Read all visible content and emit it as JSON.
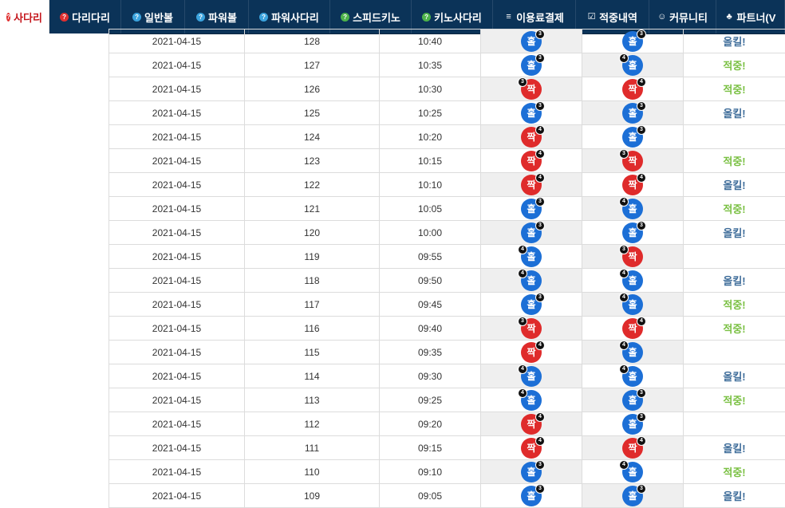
{
  "nav": {
    "items": [
      {
        "label": "사다리",
        "icon": "question-circle-icon",
        "icon_color": "red",
        "glyph": "?",
        "active": true,
        "width": 62
      },
      {
        "label": "다리다리",
        "icon": "question-circle-icon",
        "icon_color": "red",
        "glyph": "?",
        "active": false,
        "width": 90
      },
      {
        "label": "일반볼",
        "icon": "question-circle-icon",
        "icon_color": "blue",
        "glyph": "?",
        "active": false,
        "width": 80
      },
      {
        "label": "파워볼",
        "icon": "question-circle-icon",
        "icon_color": "blue",
        "glyph": "?",
        "active": false,
        "width": 80
      },
      {
        "label": "파워사다리",
        "icon": "question-circle-icon",
        "icon_color": "blue",
        "glyph": "?",
        "active": false,
        "width": 102
      },
      {
        "label": "스피드키노",
        "icon": "question-circle-icon",
        "icon_color": "green",
        "glyph": "?",
        "active": false,
        "width": 102
      },
      {
        "label": "키노사다리",
        "icon": "question-circle-icon",
        "icon_color": "green",
        "glyph": "?",
        "active": false,
        "width": 102
      },
      {
        "label": "이용료결제",
        "icon": "coins-icon",
        "icon_color": "white",
        "glyph": "≡",
        "active": false,
        "width": 104
      },
      {
        "label": "적중내역",
        "icon": "checkbox-icon",
        "icon_color": "white",
        "glyph": "☑",
        "active": false,
        "width": 92
      },
      {
        "label": "커뮤니티",
        "icon": "smiley-icon",
        "icon_color": "white",
        "glyph": "☺",
        "active": false,
        "width": 84
      },
      {
        "label": "파트너(V",
        "icon": "people-icon",
        "icon_color": "white",
        "glyph": "♣",
        "active": false,
        "width": 86
      }
    ]
  },
  "table": {
    "rows": [
      {
        "date": "2021-04-15",
        "round": "128",
        "time": "10:40",
        "b1": "홀",
        "b1t": "odd",
        "b1n": "3",
        "b1s": "right",
        "b2": "홀",
        "b2t": "odd",
        "b2n": "3",
        "b2s": "right",
        "result": "올킬!",
        "rtype": "miss"
      },
      {
        "date": "2021-04-15",
        "round": "127",
        "time": "10:35",
        "b1": "홀",
        "b1t": "odd",
        "b1n": "3",
        "b1s": "right",
        "b2": "홀",
        "b2t": "odd",
        "b2n": "4",
        "b2s": "left",
        "result": "적중!",
        "rtype": "hit"
      },
      {
        "date": "2021-04-15",
        "round": "126",
        "time": "10:30",
        "b1": "짝",
        "b1t": "even",
        "b1n": "3",
        "b1s": "left",
        "b2": "짝",
        "b2t": "even",
        "b2n": "4",
        "b2s": "right",
        "result": "적중!",
        "rtype": "hit"
      },
      {
        "date": "2021-04-15",
        "round": "125",
        "time": "10:25",
        "b1": "홀",
        "b1t": "odd",
        "b1n": "3",
        "b1s": "right",
        "b2": "홀",
        "b2t": "odd",
        "b2n": "3",
        "b2s": "right",
        "result": "올킬!",
        "rtype": "miss"
      },
      {
        "date": "2021-04-15",
        "round": "124",
        "time": "10:20",
        "b1": "짝",
        "b1t": "even",
        "b1n": "4",
        "b1s": "right",
        "b2": "홀",
        "b2t": "odd",
        "b2n": "3",
        "b2s": "right",
        "result": "",
        "rtype": ""
      },
      {
        "date": "2021-04-15",
        "round": "123",
        "time": "10:15",
        "b1": "짝",
        "b1t": "even",
        "b1n": "4",
        "b1s": "right",
        "b2": "짝",
        "b2t": "even",
        "b2n": "3",
        "b2s": "left",
        "result": "적중!",
        "rtype": "hit"
      },
      {
        "date": "2021-04-15",
        "round": "122",
        "time": "10:10",
        "b1": "짝",
        "b1t": "even",
        "b1n": "4",
        "b1s": "right",
        "b2": "짝",
        "b2t": "even",
        "b2n": "4",
        "b2s": "right",
        "result": "올킬!",
        "rtype": "miss"
      },
      {
        "date": "2021-04-15",
        "round": "121",
        "time": "10:05",
        "b1": "홀",
        "b1t": "odd",
        "b1n": "3",
        "b1s": "right",
        "b2": "홀",
        "b2t": "odd",
        "b2n": "4",
        "b2s": "left",
        "result": "적중!",
        "rtype": "hit"
      },
      {
        "date": "2021-04-15",
        "round": "120",
        "time": "10:00",
        "b1": "홀",
        "b1t": "odd",
        "b1n": "3",
        "b1s": "right",
        "b2": "홀",
        "b2t": "odd",
        "b2n": "3",
        "b2s": "right",
        "result": "올킬!",
        "rtype": "miss"
      },
      {
        "date": "2021-04-15",
        "round": "119",
        "time": "09:55",
        "b1": "홀",
        "b1t": "odd",
        "b1n": "4",
        "b1s": "left",
        "b2": "짝",
        "b2t": "even",
        "b2n": "3",
        "b2s": "left",
        "result": "",
        "rtype": ""
      },
      {
        "date": "2021-04-15",
        "round": "118",
        "time": "09:50",
        "b1": "홀",
        "b1t": "odd",
        "b1n": "4",
        "b1s": "left",
        "b2": "홀",
        "b2t": "odd",
        "b2n": "4",
        "b2s": "left",
        "result": "올킬!",
        "rtype": "miss"
      },
      {
        "date": "2021-04-15",
        "round": "117",
        "time": "09:45",
        "b1": "홀",
        "b1t": "odd",
        "b1n": "3",
        "b1s": "right",
        "b2": "홀",
        "b2t": "odd",
        "b2n": "4",
        "b2s": "left",
        "result": "적중!",
        "rtype": "hit"
      },
      {
        "date": "2021-04-15",
        "round": "116",
        "time": "09:40",
        "b1": "짝",
        "b1t": "even",
        "b1n": "3",
        "b1s": "left",
        "b2": "짝",
        "b2t": "even",
        "b2n": "4",
        "b2s": "right",
        "result": "적중!",
        "rtype": "hit"
      },
      {
        "date": "2021-04-15",
        "round": "115",
        "time": "09:35",
        "b1": "짝",
        "b1t": "even",
        "b1n": "4",
        "b1s": "right",
        "b2": "홀",
        "b2t": "odd",
        "b2n": "4",
        "b2s": "left",
        "result": "",
        "rtype": ""
      },
      {
        "date": "2021-04-15",
        "round": "114",
        "time": "09:30",
        "b1": "홀",
        "b1t": "odd",
        "b1n": "4",
        "b1s": "left",
        "b2": "홀",
        "b2t": "odd",
        "b2n": "4",
        "b2s": "left",
        "result": "올킬!",
        "rtype": "miss"
      },
      {
        "date": "2021-04-15",
        "round": "113",
        "time": "09:25",
        "b1": "홀",
        "b1t": "odd",
        "b1n": "4",
        "b1s": "left",
        "b2": "홀",
        "b2t": "odd",
        "b2n": "3",
        "b2s": "right",
        "result": "적중!",
        "rtype": "hit"
      },
      {
        "date": "2021-04-15",
        "round": "112",
        "time": "09:20",
        "b1": "짝",
        "b1t": "even",
        "b1n": "4",
        "b1s": "right",
        "b2": "홀",
        "b2t": "odd",
        "b2n": "3",
        "b2s": "right",
        "result": "",
        "rtype": ""
      },
      {
        "date": "2021-04-15",
        "round": "111",
        "time": "09:15",
        "b1": "짝",
        "b1t": "even",
        "b1n": "4",
        "b1s": "right",
        "b2": "짝",
        "b2t": "even",
        "b2n": "4",
        "b2s": "right",
        "result": "올킬!",
        "rtype": "miss"
      },
      {
        "date": "2021-04-15",
        "round": "110",
        "time": "09:10",
        "b1": "홀",
        "b1t": "odd",
        "b1n": "3",
        "b1s": "right",
        "b2": "홀",
        "b2t": "odd",
        "b2n": "4",
        "b2s": "left",
        "result": "적중!",
        "rtype": "hit"
      },
      {
        "date": "2021-04-15",
        "round": "109",
        "time": "09:05",
        "b1": "홀",
        "b1t": "odd",
        "b1n": "3",
        "b1s": "right",
        "b2": "홀",
        "b2t": "odd",
        "b2n": "3",
        "b2s": "right",
        "result": "올킬!",
        "rtype": "miss"
      }
    ]
  }
}
